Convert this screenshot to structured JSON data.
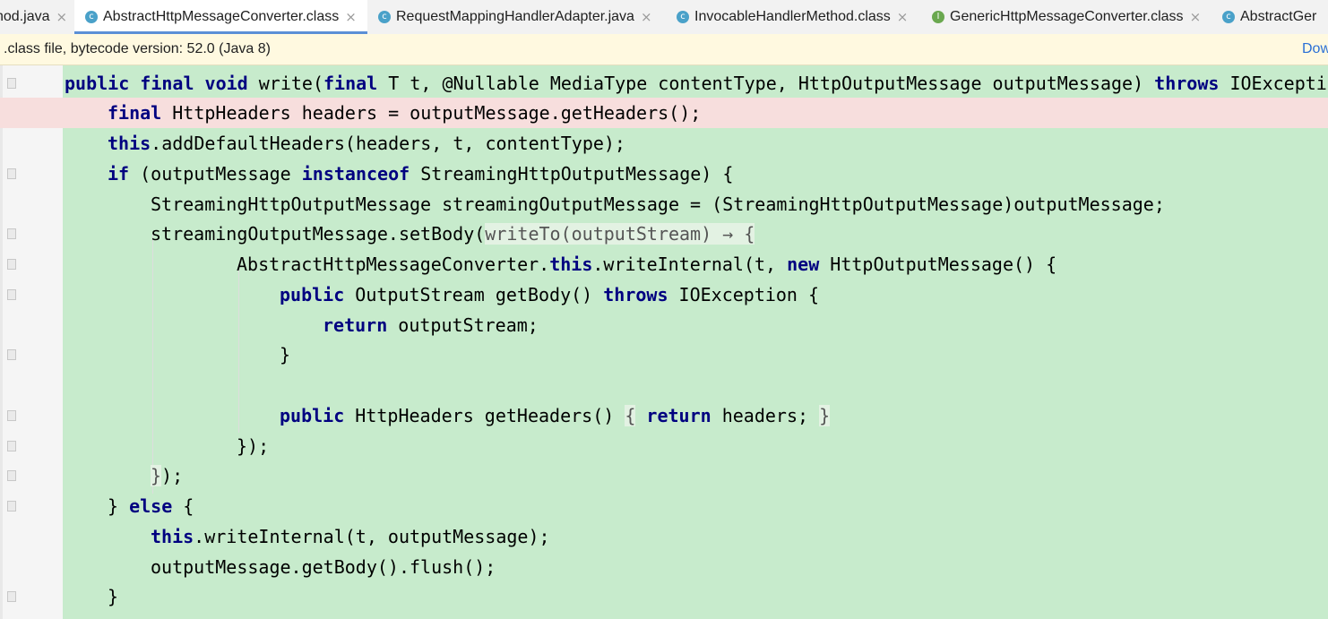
{
  "tabs": [
    {
      "label": "hod.java",
      "icon": "none",
      "active": false
    },
    {
      "label": "AbstractHttpMessageConverter.class",
      "icon": "class-icon",
      "active": true
    },
    {
      "label": "RequestMappingHandlerAdapter.java",
      "icon": "class-icon",
      "active": false
    },
    {
      "label": "InvocableHandlerMethod.class",
      "icon": "class-icon",
      "active": false
    },
    {
      "label": "GenericHttpMessageConverter.class",
      "icon": "interface-icon",
      "active": false
    },
    {
      "label": "AbstractGer",
      "icon": "class-icon",
      "active": false
    }
  ],
  "banner": {
    "text": ".class file, bytecode version: 52.0 (Java 8)",
    "link": "Dow"
  },
  "code": {
    "l1": {
      "a": "public final void",
      "b": " write(",
      "c": "final",
      "d": " T t, @Nullable MediaType contentType, HttpOutputMessage outputMessage) ",
      "e": "throws",
      "f": " IOExceptio"
    },
    "l2": {
      "a": "final",
      "b": " HttpHeaders headers = outputMessage.getHeaders();"
    },
    "l3": {
      "a": "this",
      "b": ".addDefaultHeaders(headers, t, contentType);"
    },
    "l4": {
      "a": "if",
      "b": " (outputMessage ",
      "c": "instanceof",
      "d": " StreamingHttpOutputMessage) {"
    },
    "l5": {
      "a": "StreamingHttpOutputMessage streamingOutputMessage = (StreamingHttpOutputMessage)outputMessage;"
    },
    "l6": {
      "a": "streamingOutputMessage.setBody(",
      "b": "writeTo(outputStream) → {"
    },
    "l7": {
      "a": "AbstractHttpMessageConverter.",
      "b": "this",
      "c": ".writeInternal(t, ",
      "d": "new",
      "e": " HttpOutputMessage() {"
    },
    "l8": {
      "a": "public",
      "b": " OutputStream getBody() ",
      "c": "throws",
      "d": " IOException {"
    },
    "l9": {
      "a": "return",
      "b": " outputStream;"
    },
    "l10": {
      "a": "}"
    },
    "l12": {
      "a": "public",
      "b": " HttpHeaders getHeaders() ",
      "c": "{",
      "d": " ",
      "e": "return",
      "f": " headers; ",
      "g": "}"
    },
    "l13": {
      "a": "});"
    },
    "l14": {
      "a": "}",
      "b": ");"
    },
    "l15": {
      "a": "} ",
      "b": "else",
      "c": " {"
    },
    "l16": {
      "a": "this",
      "b": ".writeInternal(t, outputMessage);"
    },
    "l17": {
      "a": "outputMessage.getBody().flush();"
    },
    "l18": {
      "a": "}"
    }
  },
  "colors": {
    "keyword": "#000080",
    "diff_added_bg": "#c7ebcc",
    "error_line_bg": "#f7dedd",
    "tab_underline": "#5b8fd6"
  }
}
